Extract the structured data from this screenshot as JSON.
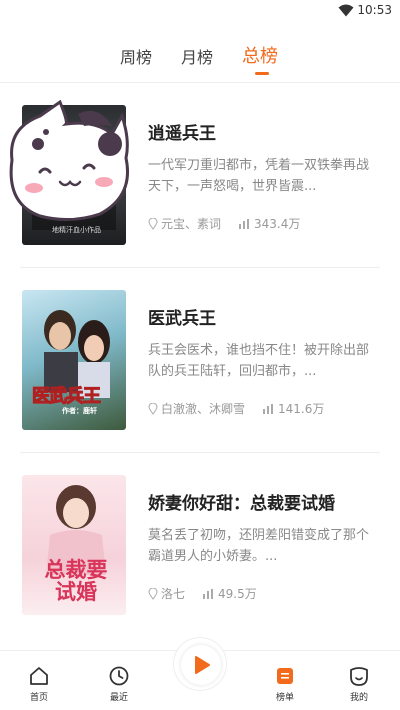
{
  "status": {
    "time": "10:53"
  },
  "tabs": [
    {
      "label": "周榜"
    },
    {
      "label": "月榜"
    },
    {
      "label": "总榜",
      "active": true
    }
  ],
  "books": [
    {
      "title": "逍遥兵王",
      "desc": "一代军刀重归都市，凭着一双铁拳再战天下，一声怒喝，世界皆震...",
      "authors": "元宝、素词",
      "count": "343.4万",
      "cover_text": "地精汗血小作品"
    },
    {
      "title": "医武兵王",
      "desc": "兵王会医术，谁也挡不住！被开除出部队的兵王陆轩，回归都市，...",
      "authors": "白澈澈、沐卿雪",
      "count": "141.6万",
      "cover_text": "医武兵王",
      "cover_sub": "作者：鹿轩"
    },
    {
      "title": "娇妻你好甜：总裁要试婚",
      "desc": "莫名丢了初吻，还阴差阳错变成了那个霸道男人的小娇妻。...",
      "authors": "洛七",
      "count": "49.5万",
      "cover_text": "总裁要试婚"
    }
  ],
  "bottom_nav": [
    {
      "label": "首页"
    },
    {
      "label": "最近"
    },
    {
      "label": ""
    },
    {
      "label": "榜单"
    },
    {
      "label": "我的"
    }
  ],
  "colors": {
    "accent": "#f26a1b"
  }
}
